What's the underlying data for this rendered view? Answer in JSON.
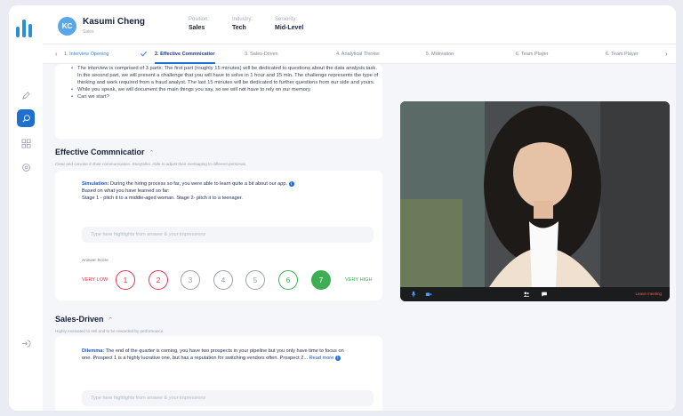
{
  "candidate": {
    "initials": "KC",
    "name": "Kasumi Cheng",
    "role": "Sales"
  },
  "meta": [
    {
      "label": "Position:",
      "value": "Sales"
    },
    {
      "label": "Industry:",
      "value": "Tech"
    },
    {
      "label": "Seniority:",
      "value": "Mid-Level"
    }
  ],
  "tabs": [
    {
      "label": "1. Interview Opening",
      "state": "done"
    },
    {
      "label": "2. Effective Commnicatior",
      "state": "active"
    },
    {
      "label": "3. Sales-Driven",
      "state": "upcoming"
    },
    {
      "label": "4. Analytical Thinker",
      "state": "upcoming"
    },
    {
      "label": "5. Motivation",
      "state": "upcoming"
    },
    {
      "label": "6. Team Player",
      "state": "upcoming"
    },
    {
      "label": "6. Team Player",
      "state": "upcoming"
    }
  ],
  "intro_bullets": [
    "The interview is comprised of 3 parts: The first part (roughly 15 minutes) will be dedicated to questions about the data analysis task. In the second part, we will present a challenge that you will have to solve in 1 hour and 15 min. The challenge represents the type of thinking and work required from a fraud analyst. The last 15 minutes will be dedicated to further questions from our side and yours.",
    "While you speak, we will document the main things you say, so we will not have to rely on our memory.",
    "Can we start?"
  ],
  "section1": {
    "title": "Effective Commnicatior",
    "description": "Clear and concise in their communication. Storyteller. Able to adjust their messaging to different personas.",
    "prompt_label": "Simulation:",
    "prompt_text": "During the hiring process so far, you were able to learn quite a bit about our app.",
    "line2": "Based on what you have learned so far:",
    "line3": "Stage 1 - pitch it to a middle-aged woman. Stage 2- pitch it to a teenager.",
    "highlights_placeholder": "Type here highlights from answer & your impressions",
    "score_label": "Answer Score",
    "scale_low": "VERY LOW",
    "scale_high": "VERY HIGH",
    "scores": [
      "1",
      "2",
      "3",
      "4",
      "5",
      "6",
      "7"
    ],
    "selected_score": 7
  },
  "section2": {
    "title": "Sales-Driven",
    "description": "Highly motivated to sell and to be rewarded by performance.",
    "prompt_label": "Dilemma:",
    "prompt_text": "The end of the quarter is coming, you have two prospects in your pipeline but you only have time to focus on one. Prospect 1 is a highly lucrative one, but has a reputation for switching vendors often. Prospect 2...",
    "read_more": "Read more",
    "highlights_placeholder": "Type here highlights from answer & your impressions"
  },
  "video": {
    "leave_label": "Leave meeting"
  },
  "colors": {
    "accent": "#1f6fd1",
    "low": "#e2364a",
    "high": "#3dae54",
    "neutral": "#9aa0ad"
  }
}
